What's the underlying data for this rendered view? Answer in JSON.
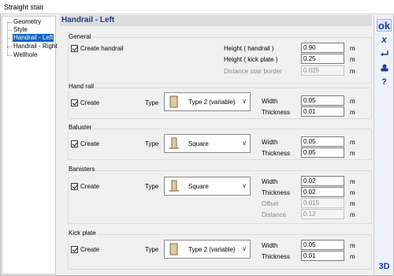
{
  "window": {
    "title": "Straight stair"
  },
  "tree": {
    "items": [
      {
        "label": "Geometry"
      },
      {
        "label": "Style"
      },
      {
        "label": "Handrail - Left",
        "selected": true
      },
      {
        "label": "Handrail - Right"
      },
      {
        "label": "Wellhole"
      }
    ]
  },
  "header": {
    "title": "Handrail - Left"
  },
  "toolbar": {
    "ok_label": "ok",
    "cancel_label": "x",
    "icons": [
      "undo-arrow-icon",
      "kit-icon",
      "help-icon"
    ],
    "help_label": "?",
    "three_d_label": "3D"
  },
  "general": {
    "title": "General",
    "create_label": "Create handrail",
    "create_checked": true,
    "height_handrail_label": "Height ( handrail )",
    "height_handrail_value": "0.90",
    "height_kick_label": "Height ( kick plate )",
    "height_kick_value": "0.25",
    "distance_label": "Distance stair border",
    "distance_value": "0.025",
    "unit": "m"
  },
  "handrail": {
    "title": "Hand rail",
    "create_label": "Create",
    "create_checked": true,
    "type_label": "Type",
    "type_value": "Type 2 (variable)",
    "type_icon": "plank-icon",
    "width_label": "Width",
    "width_value": "0.05",
    "thickness_label": "Thickness",
    "thickness_value": "0.01",
    "unit": "m"
  },
  "baluster": {
    "title": "Baluster",
    "create_label": "Create",
    "create_checked": true,
    "type_label": "Type",
    "type_value": "Square",
    "type_icon": "square-post-icon",
    "width_label": "Width",
    "width_value": "0.05",
    "thickness_label": "Thickness",
    "thickness_value": "0.05",
    "unit": "m"
  },
  "banisters": {
    "title": "Banisters",
    "create_label": "Create",
    "create_checked": true,
    "type_label": "Type",
    "type_value": "Square",
    "type_icon": "square-post-icon",
    "width_label": "Width",
    "width_value": "0.02",
    "thickness_label": "Thickness",
    "thickness_value": "0.02",
    "offset_label": "Offset",
    "offset_value": "0.015",
    "distance_label": "Distance",
    "distance_value": "0.12",
    "unit": "m"
  },
  "kickplate": {
    "title": "Kick plate",
    "create_label": "Create",
    "create_checked": true,
    "type_label": "Type",
    "type_value": "Type 2 (variable)",
    "type_icon": "plank-icon",
    "width_label": "Width",
    "width_value": "0.05",
    "thickness_label": "Thickness",
    "thickness_value": "0.01",
    "unit": "m"
  }
}
